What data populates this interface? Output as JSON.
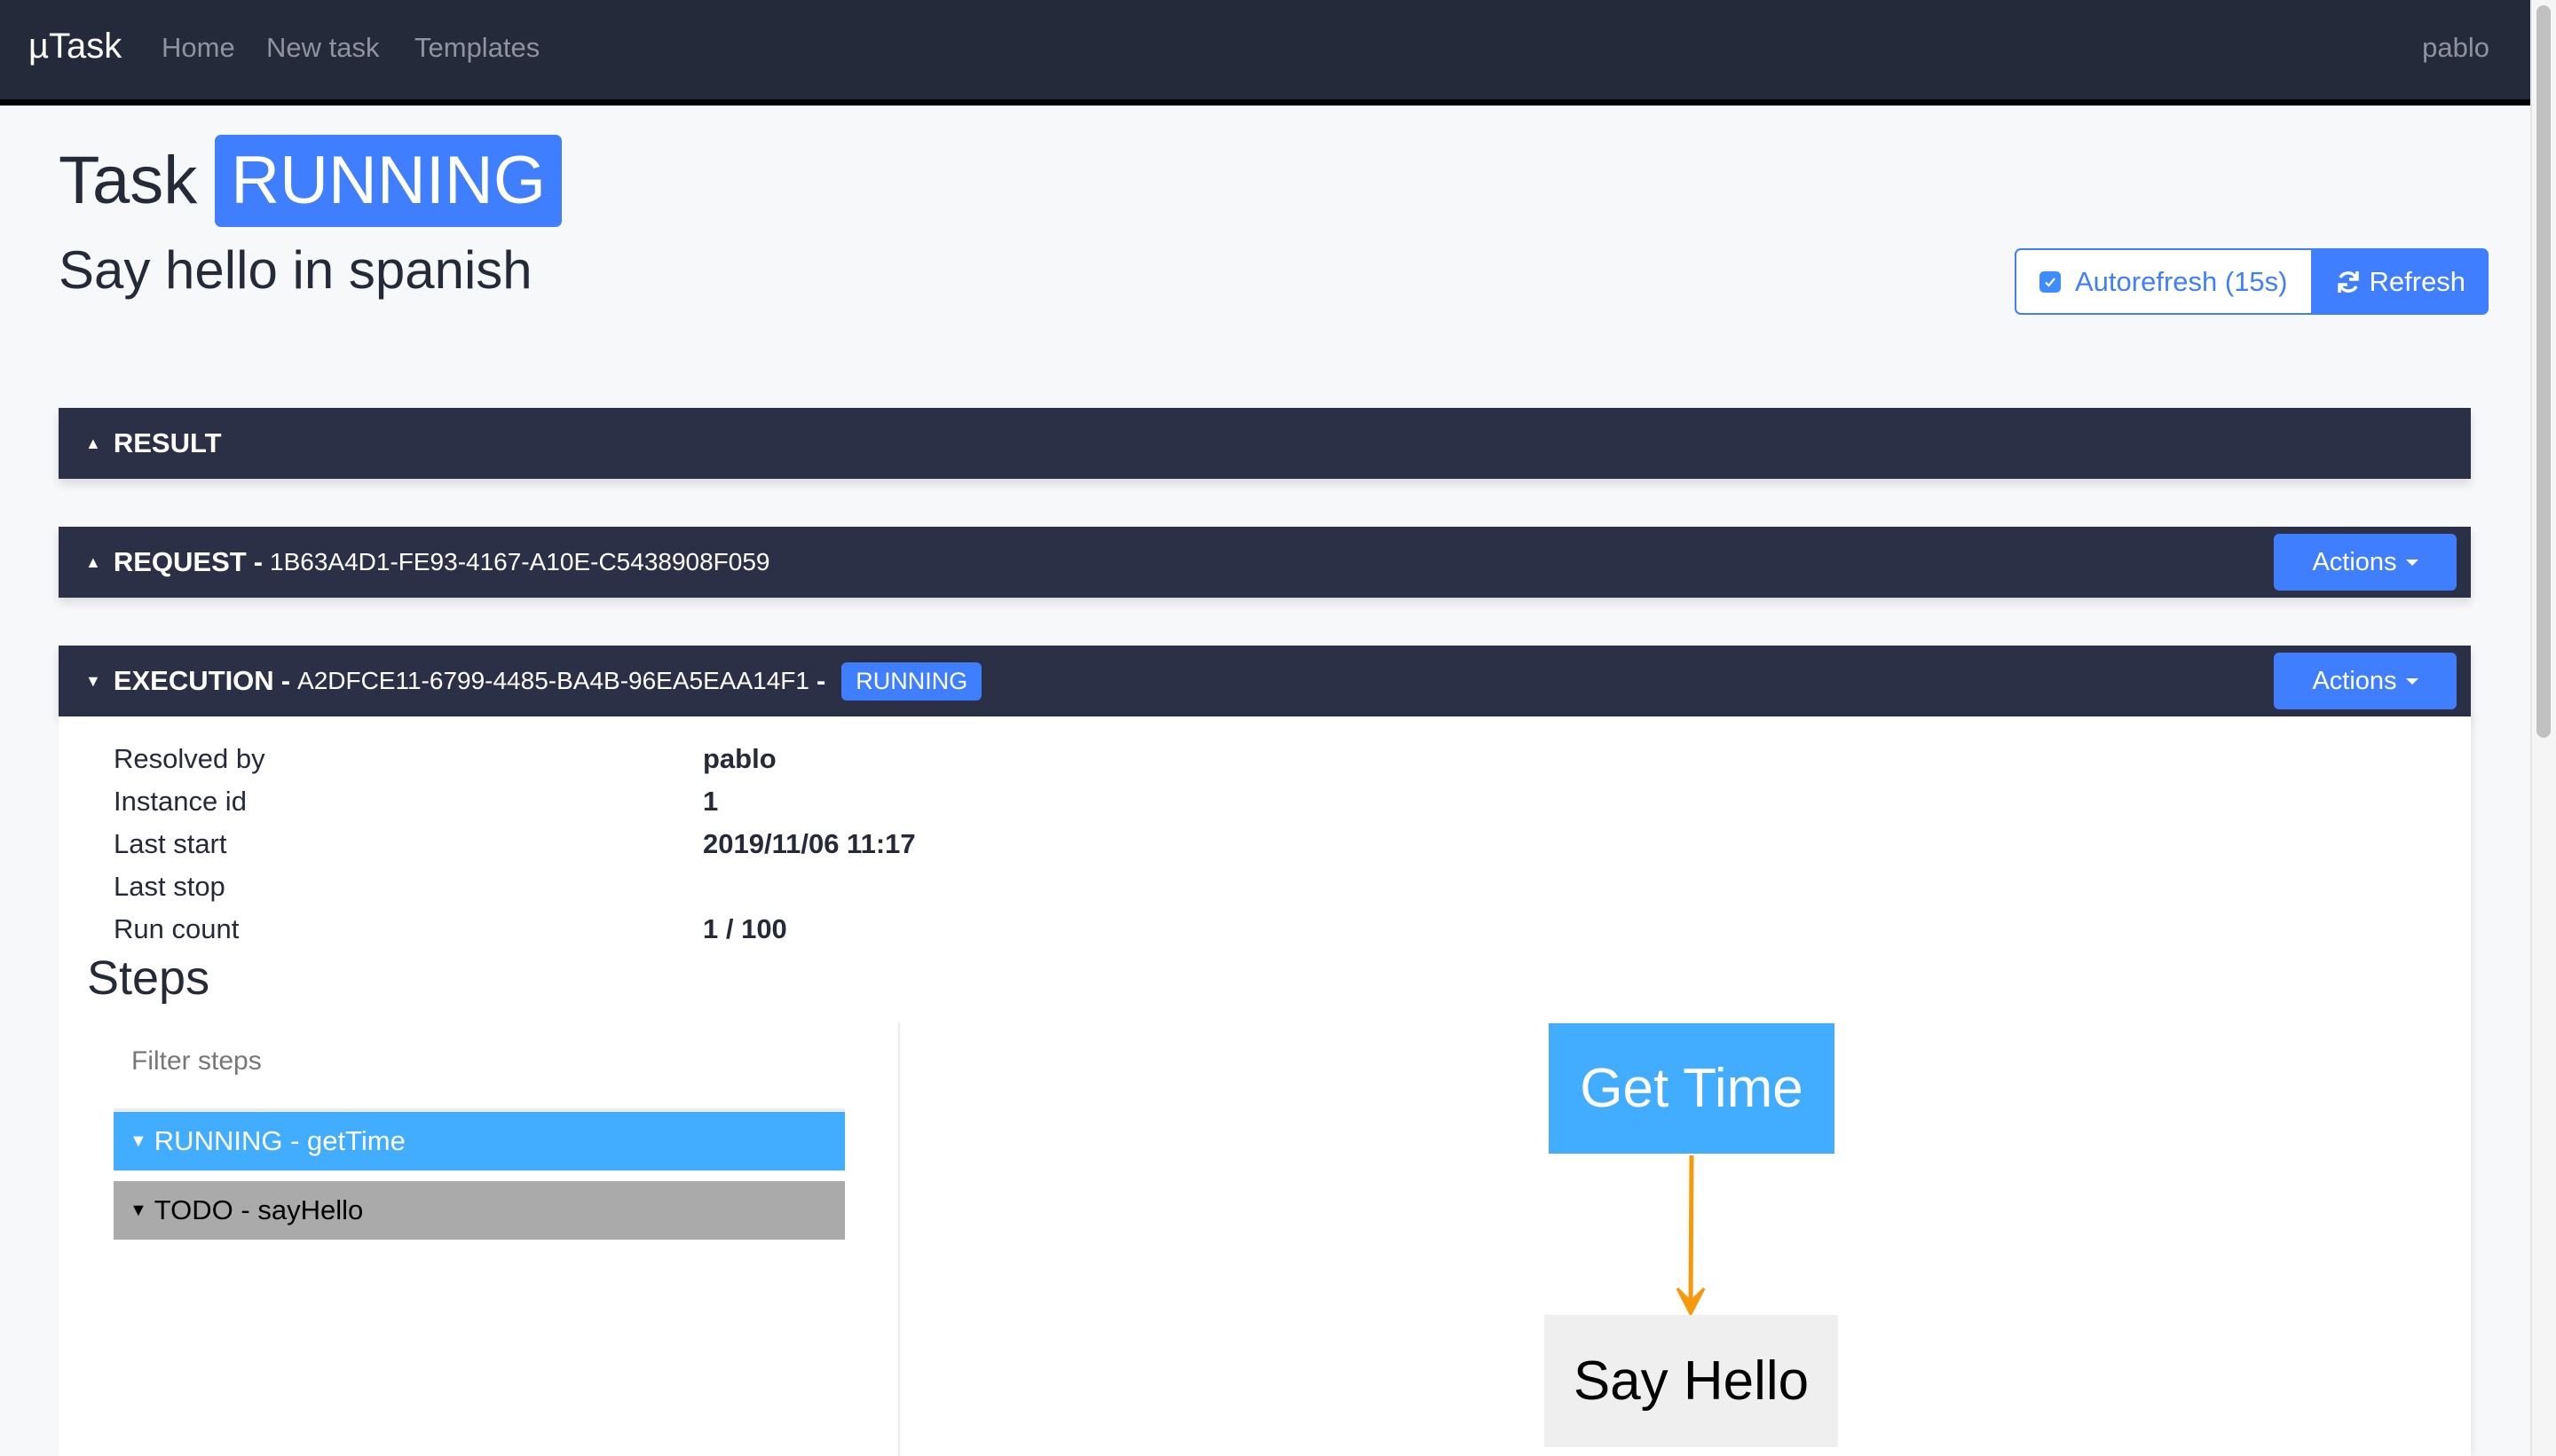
{
  "navbar": {
    "brand": "µTask",
    "links": [
      "Home",
      "New task",
      "Templates"
    ],
    "user": "pablo"
  },
  "header": {
    "title": "Task",
    "state_badge": "RUNNING",
    "subtitle": "Say hello in spanish",
    "autorefresh_label": "Autorefresh (15s)",
    "autorefresh_checked": true,
    "refresh_label": "Refresh"
  },
  "panels": {
    "result": {
      "title": "RESULT",
      "expanded": false
    },
    "request": {
      "title": "REQUEST",
      "separator": "-",
      "id": "1B63A4D1-FE93-4167-A10E-C5438908F059",
      "actions_label": "Actions",
      "expanded": false
    },
    "execution": {
      "title": "EXECUTION",
      "separator": "-",
      "id": "A2DFCE11-6799-4485-BA4B-96EA5EAA14F1",
      "separator2": "-",
      "state_badge": "RUNNING",
      "actions_label": "Actions",
      "expanded": true
    }
  },
  "execution_details": [
    {
      "label": "Resolved by",
      "value": "pablo"
    },
    {
      "label": "Instance id",
      "value": "1"
    },
    {
      "label": "Last start",
      "value": "2019/11/06 11:17"
    },
    {
      "label": "Last stop",
      "value": ""
    },
    {
      "label": "Run count",
      "value": "1 / 100"
    }
  ],
  "steps": {
    "heading": "Steps",
    "filter_placeholder": "Filter steps",
    "items": [
      {
        "label": "RUNNING - getTime",
        "state": "RUNNING",
        "color": "#42acff"
      },
      {
        "label": "TODO - sayHello",
        "state": "TODO",
        "color": "#aaaaaa"
      }
    ],
    "graph": {
      "nodes": [
        {
          "label": "Get Time",
          "state": "RUNNING"
        },
        {
          "label": "Say Hello",
          "state": "TODO"
        }
      ],
      "edges": [
        {
          "from": "Get Time",
          "to": "Say Hello",
          "color": "#f7990c"
        }
      ]
    }
  },
  "colors": {
    "primary": "#3f7eff",
    "navbar": "#252a3a",
    "panel_header": "#2c3046",
    "running": "#42acff",
    "todo": "#aaaaaa",
    "edge": "#f7990c"
  }
}
